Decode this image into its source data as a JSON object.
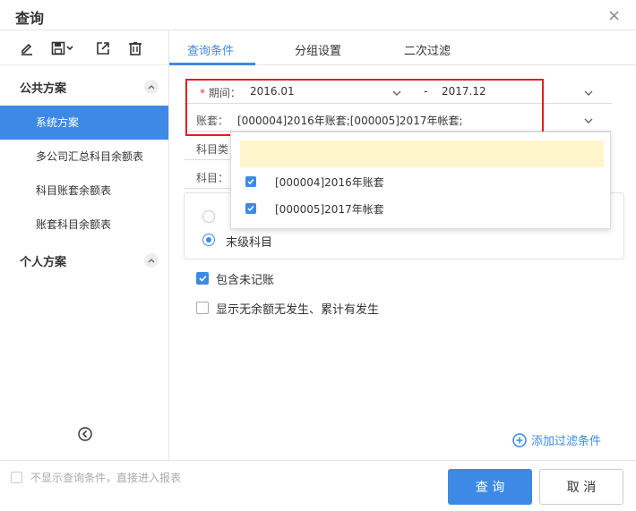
{
  "dialog": {
    "title": "查询",
    "close_glyph": "×"
  },
  "sidebar": {
    "public_group": "公共方案",
    "public_items": [
      "系统方案",
      "多公司汇总科目余额表",
      "科目账套余额表",
      "账套科目余额表"
    ],
    "personal_group": "个人方案"
  },
  "tabs": [
    "查询条件",
    "分组设置",
    "二次过滤"
  ],
  "form": {
    "period_required_mark": "*",
    "period_label": "期间：",
    "period_start": "2016.01",
    "period_dash": "-",
    "period_end": "2017.12",
    "ledger_label": "账套：",
    "ledger_value": "[000004]2016年账套;[000005]2017年帐套;",
    "subject_type_label": "科目类",
    "subject_label": "科目："
  },
  "dropdown": {
    "items": [
      "[000004]2016年账套",
      "[000005]2017年帐套"
    ]
  },
  "options": {
    "leaf_subject_label": "末级科目",
    "include_unposted_label": "包含未记账",
    "show_no_balance_label": "显示无余额无发生、累计有发生"
  },
  "add_filter_label": "添加过滤条件",
  "footer": {
    "skip_note": "不显示查询条件，直接进入报表",
    "query_button": "查 询",
    "cancel_button": "取 消"
  },
  "colors": {
    "accent": "#3d8ae6",
    "highlight_border": "#e02020",
    "search_bg": "#fef5cc"
  }
}
